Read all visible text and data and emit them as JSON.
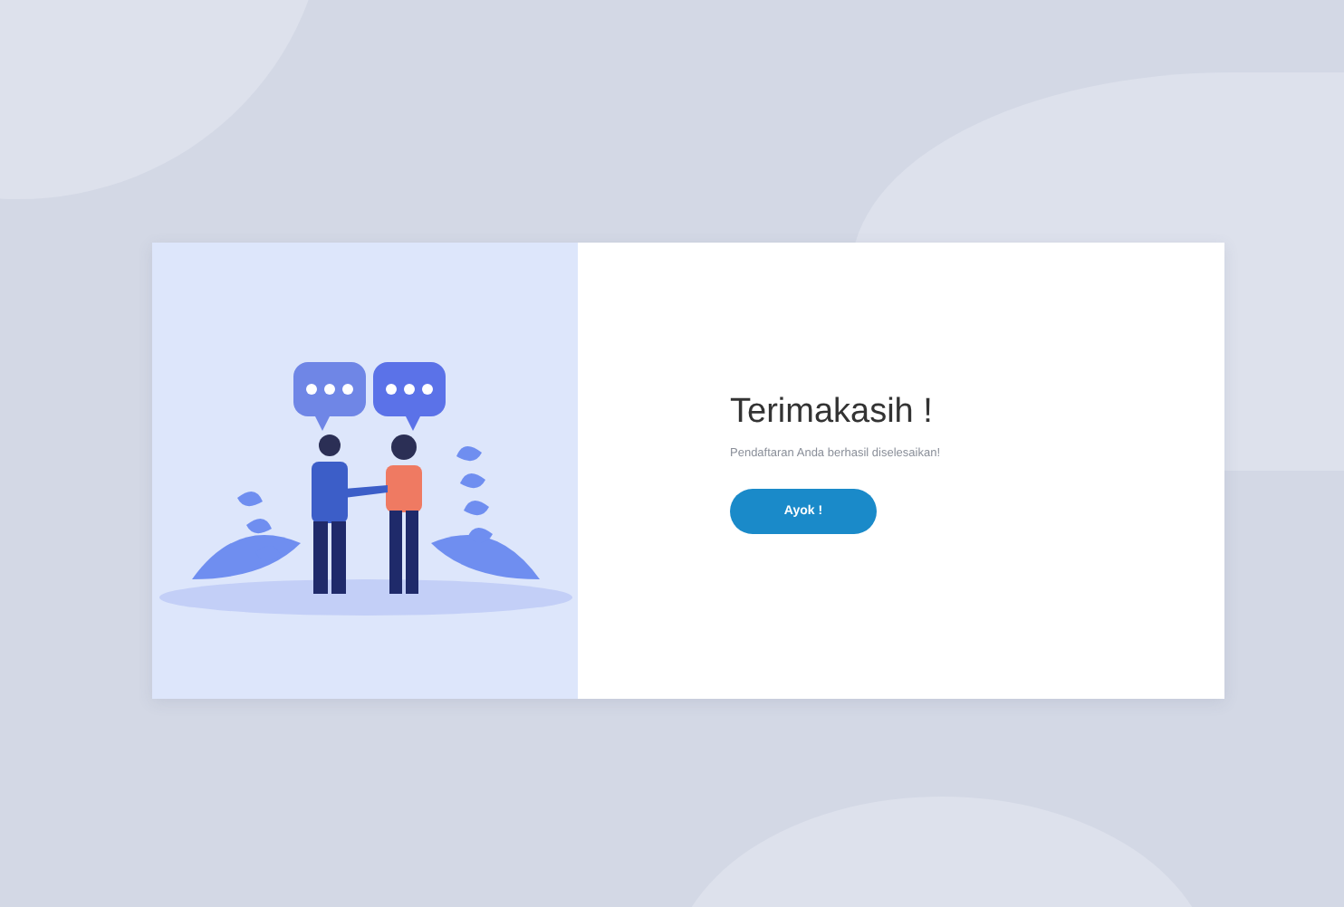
{
  "card": {
    "title": "Terimakasih !",
    "message": "Pendaftaran Anda berhasil diselesaikan!",
    "button": "Ayok !"
  }
}
